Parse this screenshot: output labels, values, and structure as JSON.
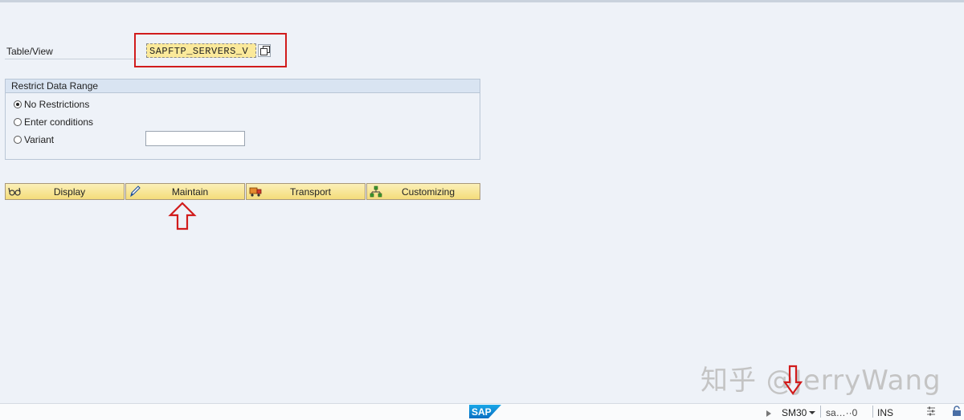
{
  "table_view": {
    "label": "Table/View",
    "value": "SAPFTP_SERVERS_V"
  },
  "restrict_group": {
    "title": "Restrict Data Range",
    "options": [
      {
        "label": "No Restrictions",
        "selected": true
      },
      {
        "label": "Enter conditions",
        "selected": false
      },
      {
        "label": "Variant",
        "selected": false
      }
    ],
    "variant_value": ""
  },
  "actions": {
    "display": {
      "label": "Display",
      "icon": "glasses-icon"
    },
    "maintain": {
      "label": "Maintain",
      "icon": "pencil-icon"
    },
    "transport": {
      "label": "Transport",
      "icon": "truck-icon"
    },
    "customizing": {
      "label": "Customizing",
      "icon": "hierarchy-icon"
    }
  },
  "watermark": "知乎 @JerryWang",
  "statusbar": {
    "logo": "SAP",
    "tcode": "SM30",
    "server": "sa…··0",
    "mode": "INS"
  },
  "colors": {
    "background": "#eef2f8",
    "field_highlight": "#fbe99a",
    "annotation_red": "#d11c1c",
    "button_yellow": "#f4dc7a"
  }
}
